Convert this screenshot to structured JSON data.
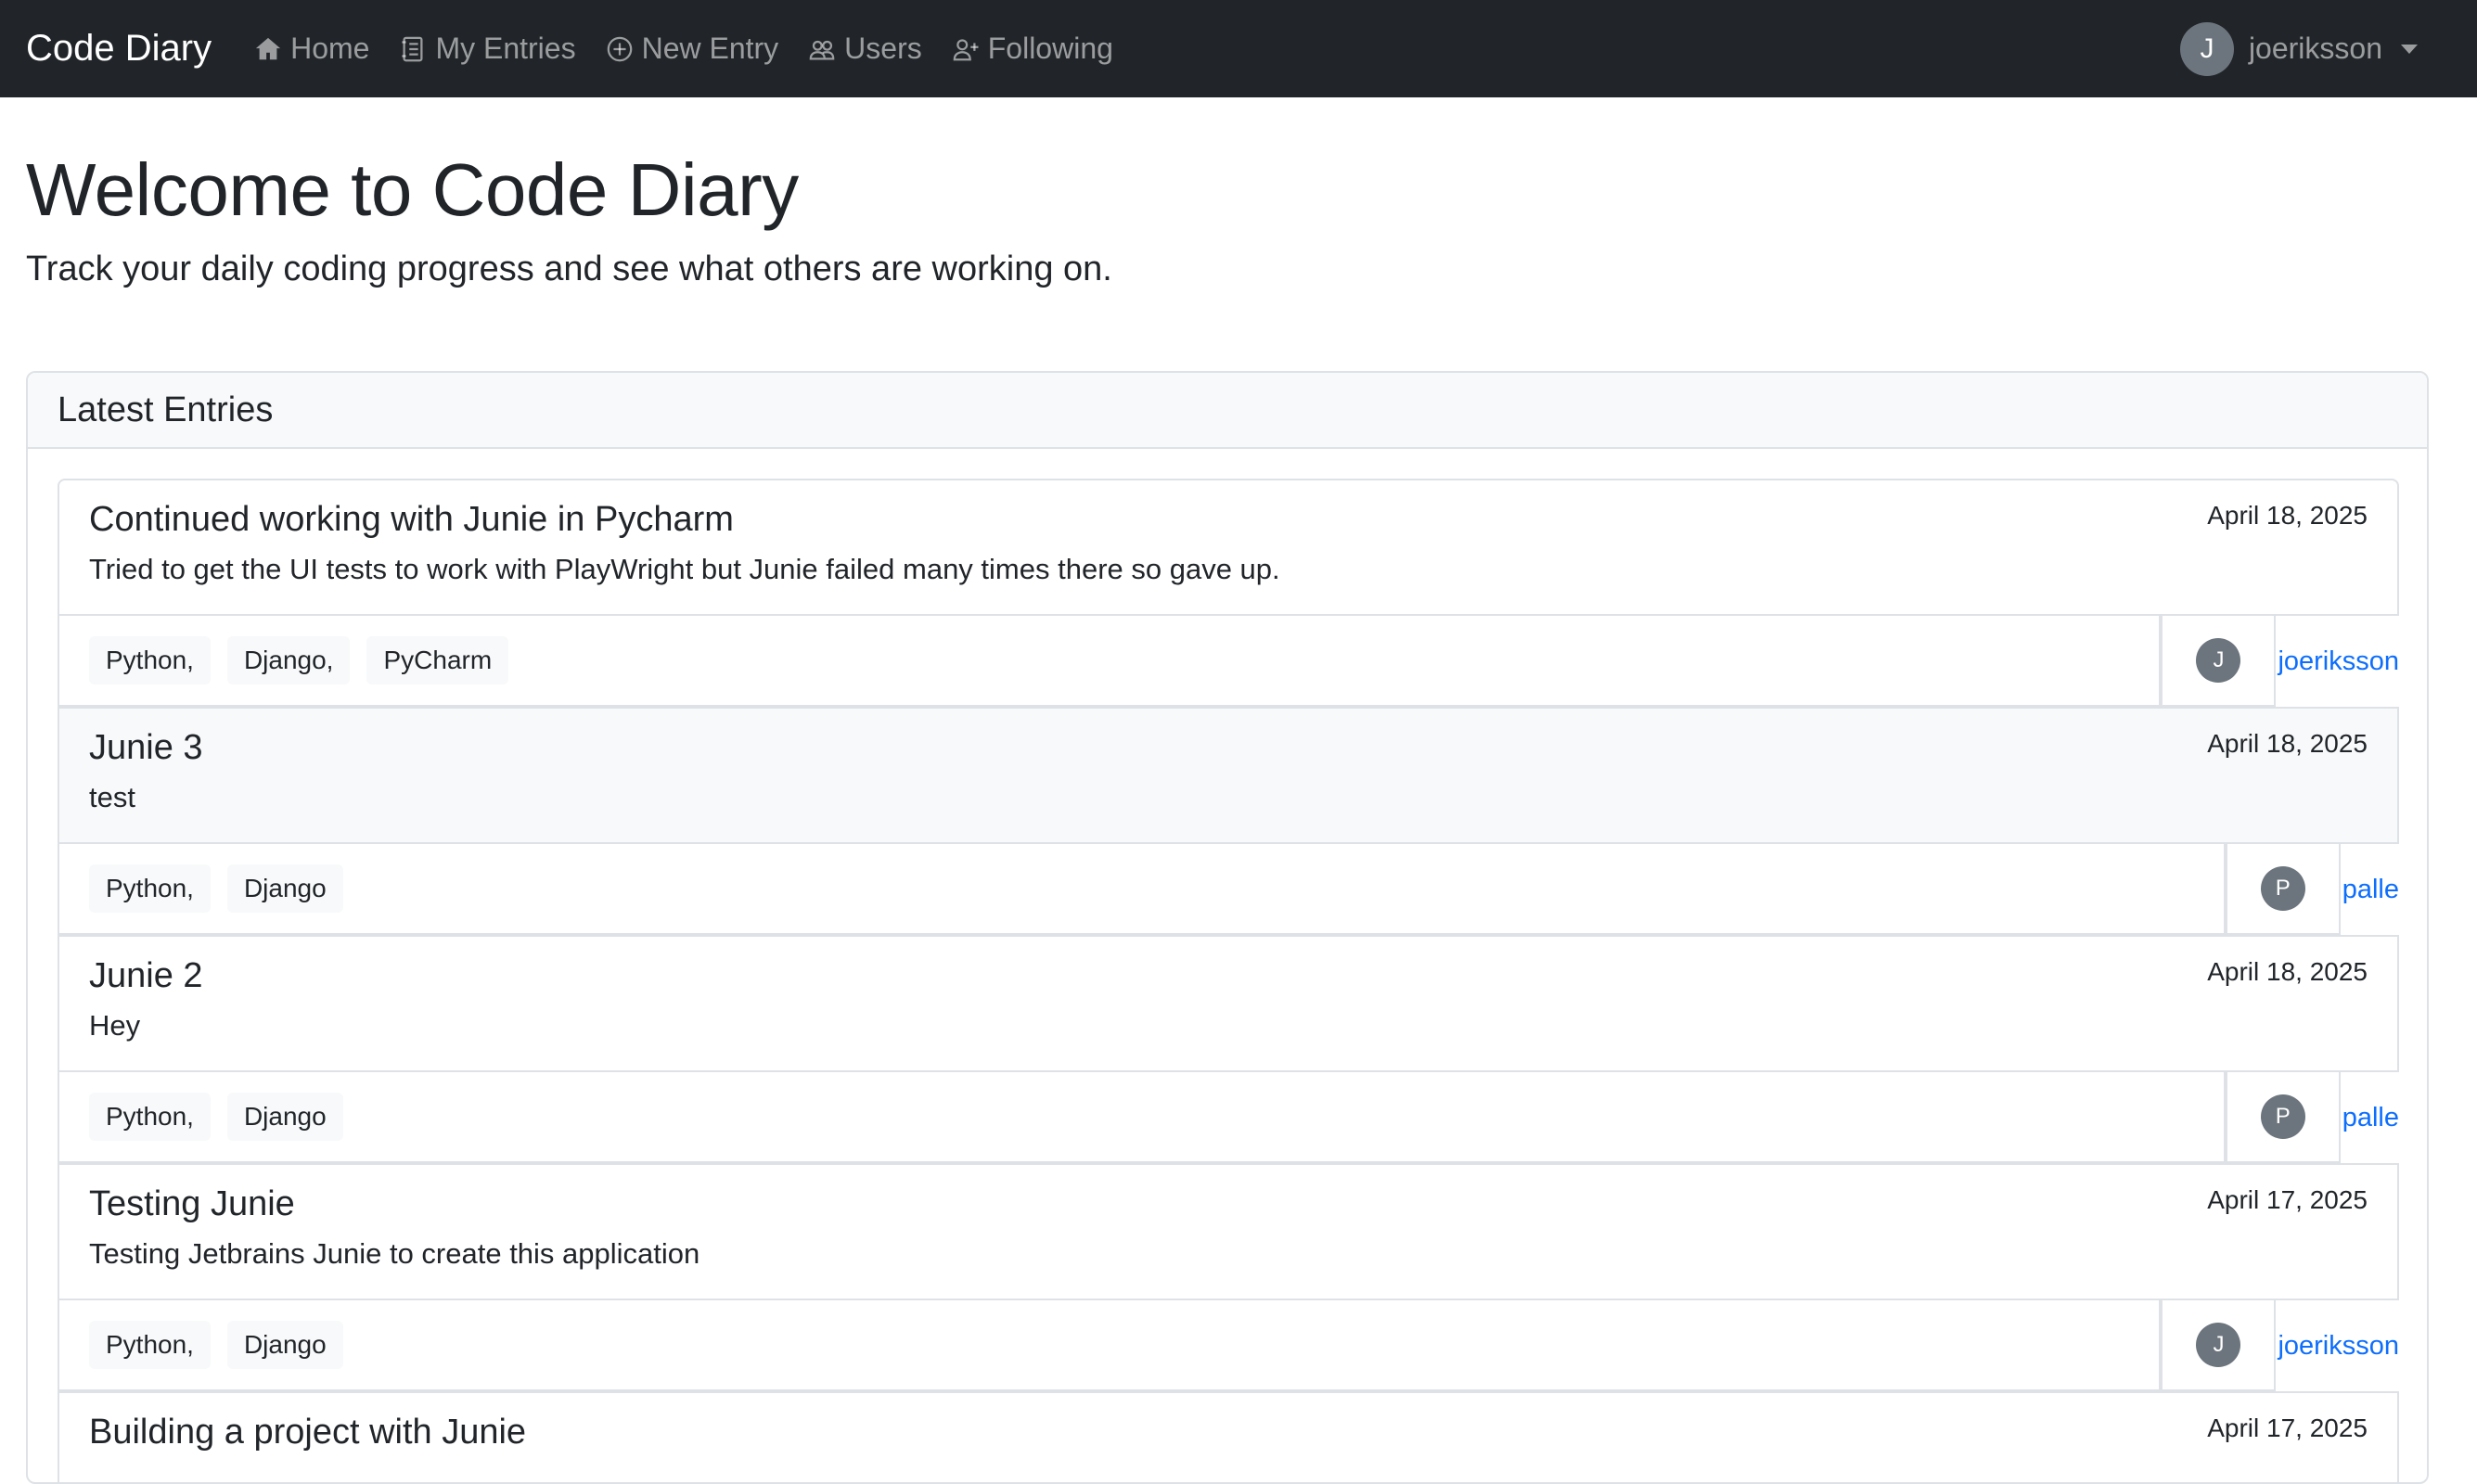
{
  "navbar": {
    "brand": "Code Diary",
    "links": [
      {
        "label": "Home",
        "icon": "house-icon"
      },
      {
        "label": "My Entries",
        "icon": "journal-icon"
      },
      {
        "label": "New Entry",
        "icon": "plus-circle-icon"
      },
      {
        "label": "Users",
        "icon": "people-icon"
      },
      {
        "label": "Following",
        "icon": "person-plus-icon"
      }
    ],
    "user": {
      "initial": "J",
      "name": "joeriksson"
    }
  },
  "hero": {
    "title": "Welcome to Code Diary",
    "lead": "Track your daily coding progress and see what others are working on."
  },
  "latest": {
    "header": "Latest Entries",
    "entries": [
      {
        "title": "Continued working with Junie in Pycharm",
        "text": "Tried to get the UI tests to work with PlayWright but Junie failed many times there so gave up.",
        "date": "April 18, 2025",
        "tags": [
          "Python,",
          "Django,",
          "PyCharm"
        ],
        "author_initial": "J",
        "author": "joeriksson"
      },
      {
        "title": "Junie 3",
        "text": "test",
        "date": "April 18, 2025",
        "tags": [
          "Python,",
          "Django"
        ],
        "author_initial": "P",
        "author": "palle"
      },
      {
        "title": "Junie 2",
        "text": "Hey",
        "date": "April 18, 2025",
        "tags": [
          "Python,",
          "Django"
        ],
        "author_initial": "P",
        "author": "palle"
      },
      {
        "title": "Testing Junie",
        "text": "Testing Jetbrains Junie to create this application",
        "date": "April 17, 2025",
        "tags": [
          "Python,",
          "Django"
        ],
        "author_initial": "J",
        "author": "joeriksson"
      },
      {
        "title": "Building a project with Junie",
        "text": "",
        "date": "April 17, 2025",
        "tags": [],
        "author_initial": "",
        "author": ""
      }
    ]
  }
}
